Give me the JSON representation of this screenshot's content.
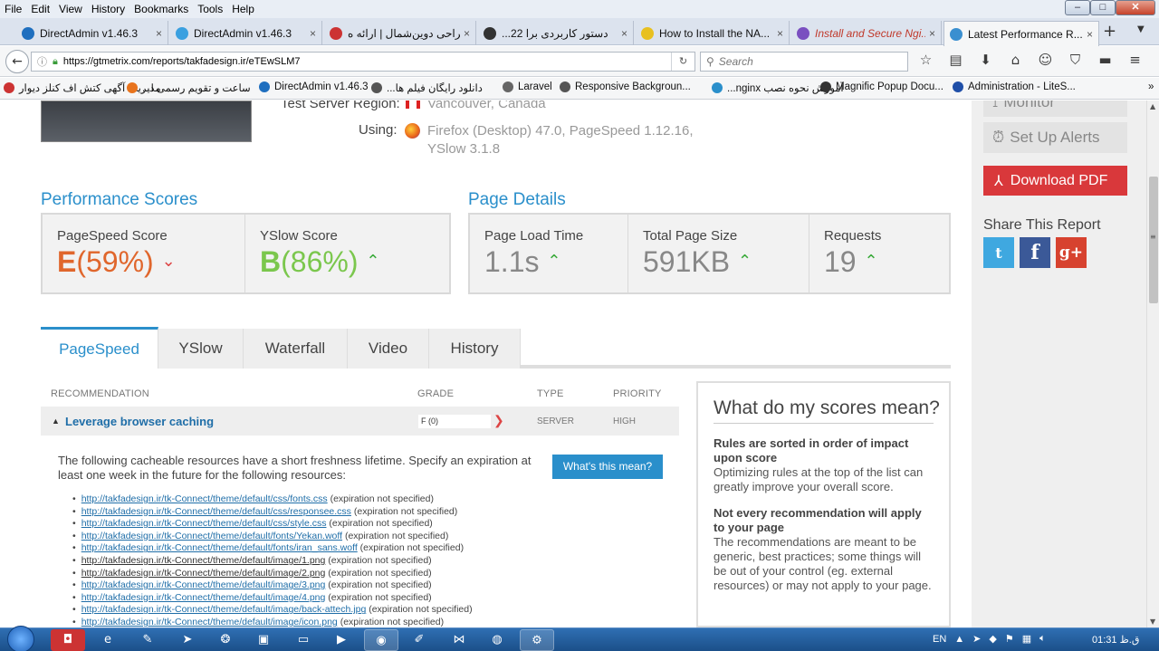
{
  "menu": {
    "file": "File",
    "edit": "Edit",
    "view": "View",
    "history": "History",
    "bookmarks": "Bookmarks",
    "tools": "Tools",
    "help": "Help"
  },
  "window": {
    "minimize": "–",
    "maximize": "□",
    "close": "✕"
  },
  "tabs": [
    {
      "label": "DirectAdmin v1.46.3",
      "color": "#1f6fbf"
    },
    {
      "label": "DirectAdmin v1.46.3",
      "color": "#3aa0e0"
    },
    {
      "label": "شرکت طراحی دوین‌شمال | ارائه ه",
      "color": "#c33"
    },
    {
      "label": "...دستور کاربردی برا 22",
      "color": "#333"
    },
    {
      "label": "How to Install the NA...",
      "color": "#e8c020"
    },
    {
      "label": "Install and Secure Ngi...",
      "color": "#7a4fc0"
    },
    {
      "label": "Latest Performance R...",
      "color": "#3a8fd0"
    }
  ],
  "tab_close": "×",
  "new_tab": "+",
  "nav": {
    "back": "←",
    "url": "https://gtmetrix.com/reports/takfadesign.ir/eTEwSLM7",
    "reload": "↻",
    "search_placeholder": "Search",
    "icons": [
      "star-icon",
      "reader-icon",
      "download-icon",
      "home-icon",
      "chat-icon",
      "pocket-icon",
      "addon-icon",
      "menu-icon"
    ],
    "icon_glyphs": [
      "☆",
      "▤",
      "⬇",
      "⌂",
      "☺",
      "⛉",
      "▬",
      "≡"
    ]
  },
  "bookmarks": [
    {
      "label": "مدیریت آگهی کتش اف کنلز دیوار",
      "color": "#c33"
    },
    {
      "label": "...ساعت و تقویم رسمی ا",
      "color": "#e8741e"
    },
    {
      "label": "DirectAdmin v1.46.3",
      "color": "#1f6fbf"
    },
    {
      "label": "...دانلود رایگان فیلم ها",
      "color": "#555"
    },
    {
      "label": "Laravel",
      "color": "#666"
    },
    {
      "label": "Responsive Backgroun...",
      "color": "#555"
    },
    {
      "label": "...nginx آموزش نحوه نصب",
      "color": "#2a8fcb"
    },
    {
      "label": "Magnific Popup Docu...",
      "color": "#333"
    },
    {
      "label": "Administration - LiteS...",
      "color": "#1f4fa8"
    }
  ],
  "bookmarks_more": "»",
  "server": {
    "region_label": "Test Server Region:",
    "region_value": "Vancouver, Canada",
    "using_label": "Using:",
    "using_value": "Firefox (Desktop) 47.0, PageSpeed 1.12.16, YSlow 3.1.8"
  },
  "performance": {
    "heading": "Performance Scores",
    "pagespeed_label": "PageSpeed Score",
    "pagespeed_grade": "E",
    "pagespeed_pct": "(59%)",
    "yslow_label": "YSlow Score",
    "yslow_grade": "B",
    "yslow_pct": "(86%)"
  },
  "details": {
    "heading": "Page Details",
    "load_label": "Page Load Time",
    "load_value": "1.1s",
    "size_label": "Total Page Size",
    "size_value": "591KB",
    "req_label": "Requests",
    "req_value": "19"
  },
  "report_tabs": [
    "PageSpeed",
    "YSlow",
    "Waterfall",
    "Video",
    "History"
  ],
  "table": {
    "col_rec": "RECOMMENDATION",
    "col_grade": "GRADE",
    "col_type": "TYPE",
    "col_priority": "PRIORITY",
    "rec_title": "Leverage browser caching",
    "rec_grade": "F (0)",
    "rec_type": "SERVER",
    "rec_priority": "HIGH",
    "description": "The following cacheable resources have a short freshness lifetime. Specify an expiration at least one week in the future for the following resources:",
    "whats_button": "What's this mean?",
    "resources": [
      {
        "url": "http://takfadesign.ir/tk-Connect/theme/default/css/fonts.css",
        "note": "(expiration not specified)"
      },
      {
        "url": "http://takfadesign.ir/tk-Connect/theme/default/css/responsee.css",
        "note": "(expiration not specified)"
      },
      {
        "url": "http://takfadesign.ir/tk-Connect/theme/default/css/style.css",
        "note": "(expiration not specified)"
      },
      {
        "url": "http://takfadesign.ir/tk-Connect/theme/default/fonts/Yekan.woff",
        "note": "(expiration not specified)"
      },
      {
        "url": "http://takfadesign.ir/tk-Connect/theme/default/fonts/iran_sans.woff",
        "note": "(expiration not specified)"
      },
      {
        "url": "http://takfadesign.ir/tk-Connect/theme/default/image/1.png",
        "note": "(expiration not specified)"
      },
      {
        "url": "http://takfadesign.ir/tk-Connect/theme/default/image/2.png",
        "note": "(expiration not specified)"
      },
      {
        "url": "http://takfadesign.ir/tk-Connect/theme/default/image/3.png",
        "note": "(expiration not specified)"
      },
      {
        "url": "http://takfadesign.ir/tk-Connect/theme/default/image/4.png",
        "note": "(expiration not specified)"
      },
      {
        "url": "http://takfadesign.ir/tk-Connect/theme/default/image/back-attech.jpg",
        "note": "(expiration not specified)"
      },
      {
        "url": "http://takfadesign.ir/tk-Connect/theme/default/image/icon.png",
        "note": "(expiration not specified)"
      }
    ]
  },
  "info": {
    "title": "What do my scores mean?",
    "h1": "Rules are sorted in order of impact upon score",
    "p1": "Optimizing rules at the top of the list can greatly improve your overall score.",
    "h2": "Not every recommendation will apply to your page",
    "p2": "The recommendations are meant to be generic, best practices; some things will be out of your control (eg. external resources) or may not apply to your page."
  },
  "sidebar": {
    "monitor": "Monitor",
    "alerts": "Set Up Alerts",
    "pdf": "Download PDF",
    "share": "Share This Report",
    "twitter": "t",
    "facebook": "f",
    "gplus": "g+"
  },
  "taskbar": {
    "lang": "EN",
    "time": "01:31 ق.ظ"
  },
  "colors": {
    "accent": "#2a8fcb",
    "pdf": "#d9383b",
    "grade_e": "#e0662c",
    "grade_b": "#7bc74d",
    "twitter": "#3fa8e0",
    "facebook": "#3b5998",
    "gplus": "#d7422f"
  }
}
